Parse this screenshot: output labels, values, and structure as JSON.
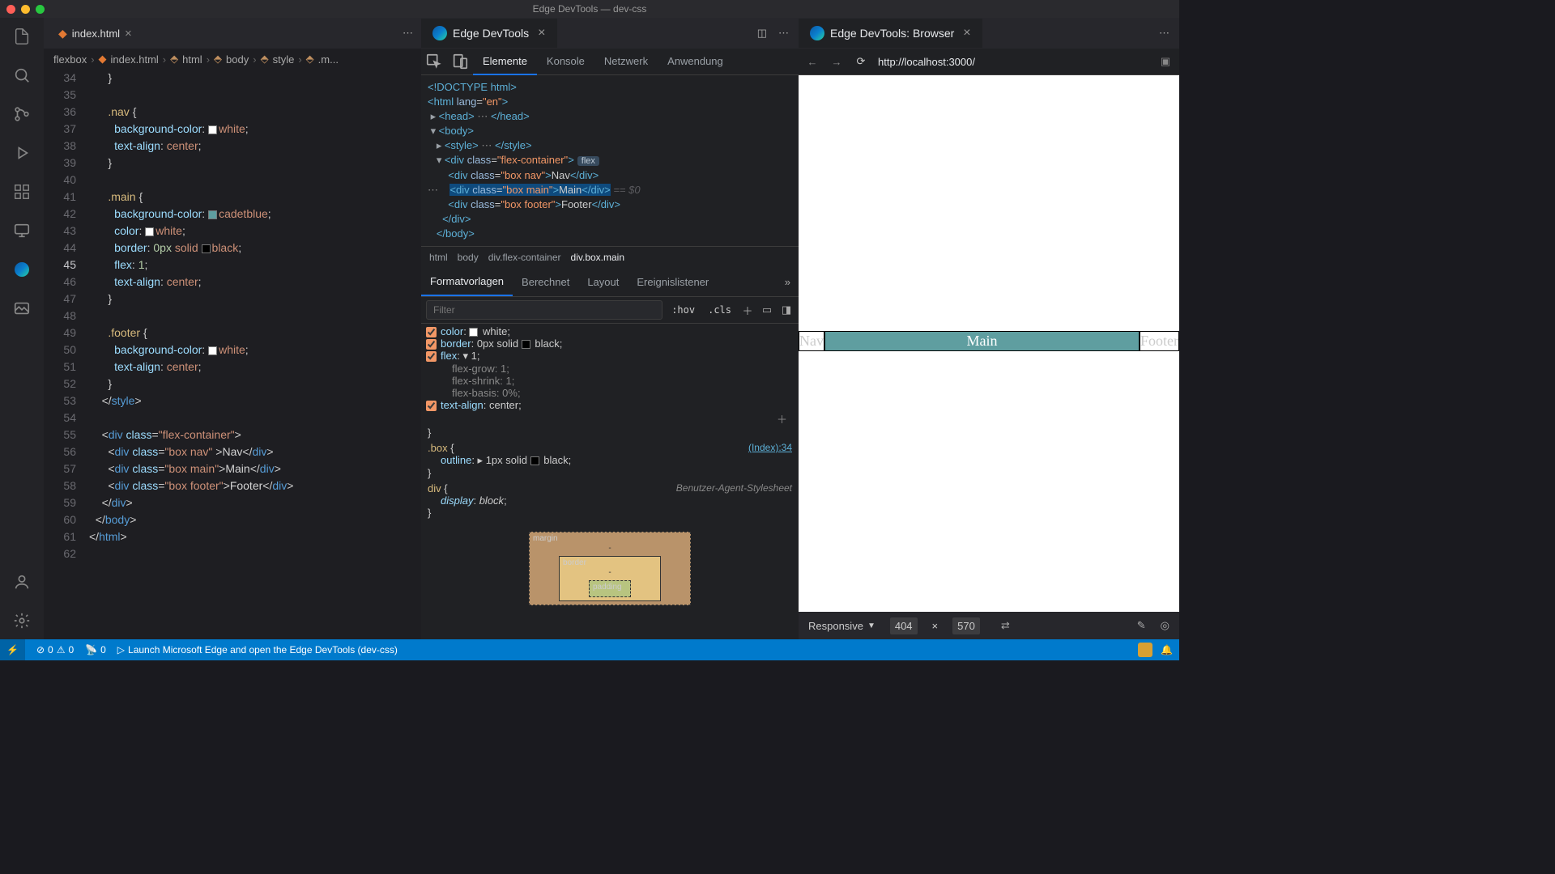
{
  "window": {
    "title": "Edge DevTools — dev-css"
  },
  "editor": {
    "tab": {
      "filename": "index.html"
    },
    "breadcrumb": [
      "flexbox",
      "index.html",
      "html",
      "body",
      "style",
      ".m..."
    ],
    "lines": [
      {
        "n": 34,
        "html": "      <span class='s-punc'>}</span>"
      },
      {
        "n": 35,
        "html": ""
      },
      {
        "n": 36,
        "html": "      <span class='s-sel'>.nav</span> <span class='s-punc'>{</span>"
      },
      {
        "n": 37,
        "html": "        <span class='s-prop'>background-color</span>: <span class='swatch sw-white'></span><span class='s-val'>white</span>;"
      },
      {
        "n": 38,
        "html": "        <span class='s-prop'>text-align</span>: <span class='s-val'>center</span>;"
      },
      {
        "n": 39,
        "html": "      <span class='s-punc'>}</span>"
      },
      {
        "n": 40,
        "html": ""
      },
      {
        "n": 41,
        "html": "      <span class='s-sel'>.main</span> <span class='s-punc'>{</span>"
      },
      {
        "n": 42,
        "html": "        <span class='s-prop'>background-color</span>: <span class='swatch sw-cadet'></span><span class='s-val'>cadetblue</span>;"
      },
      {
        "n": 43,
        "html": "        <span class='s-prop'>color</span>: <span class='swatch sw-white'></span><span class='s-val'>white</span>;"
      },
      {
        "n": 44,
        "html": "        <span class='s-prop'>border</span>: <span class='s-num'>0px</span> <span class='s-val'>solid</span> <span class='swatch sw-black'></span><span class='s-val'>black</span>;"
      },
      {
        "n": 45,
        "active": true,
        "html": "        <span class='s-prop'>flex</span>: <span class='s-num'>1</span>;"
      },
      {
        "n": 46,
        "html": "        <span class='s-prop'>text-align</span>: <span class='s-val'>center</span>;"
      },
      {
        "n": 47,
        "html": "      <span class='s-punc'>}</span>"
      },
      {
        "n": 48,
        "html": ""
      },
      {
        "n": 49,
        "html": "      <span class='s-sel'>.footer</span> <span class='s-punc'>{</span>"
      },
      {
        "n": 50,
        "html": "        <span class='s-prop'>background-color</span>: <span class='swatch sw-white'></span><span class='s-val'>white</span>;"
      },
      {
        "n": 51,
        "html": "        <span class='s-prop'>text-align</span>: <span class='s-val'>center</span>;"
      },
      {
        "n": 52,
        "html": "      <span class='s-punc'>}</span>"
      },
      {
        "n": 53,
        "html": "    <span class='s-punc'>&lt;/</span><span class='s-tag'>style</span><span class='s-punc'>&gt;</span>"
      },
      {
        "n": 54,
        "html": ""
      },
      {
        "n": 55,
        "html": "    <span class='s-punc'>&lt;</span><span class='s-tag'>div</span> <span class='s-attr'>class</span>=<span class='s-str'>\"flex-container\"</span><span class='s-punc'>&gt;</span>"
      },
      {
        "n": 56,
        "html": "      <span class='s-punc'>&lt;</span><span class='s-tag'>div</span> <span class='s-attr'>class</span>=<span class='s-str'>\"box nav\"</span> <span class='s-punc'>&gt;</span><span class='s-txt'>Nav</span><span class='s-punc'>&lt;/</span><span class='s-tag'>div</span><span class='s-punc'>&gt;</span>"
      },
      {
        "n": 57,
        "html": "      <span class='s-punc'>&lt;</span><span class='s-tag'>div</span> <span class='s-attr'>class</span>=<span class='s-str'>\"box main\"</span><span class='s-punc'>&gt;</span><span class='s-txt'>Main</span><span class='s-punc'>&lt;/</span><span class='s-tag'>div</span><span class='s-punc'>&gt;</span>"
      },
      {
        "n": 58,
        "html": "      <span class='s-punc'>&lt;</span><span class='s-tag'>div</span> <span class='s-attr'>class</span>=<span class='s-str'>\"box footer\"</span><span class='s-punc'>&gt;</span><span class='s-txt'>Footer</span><span class='s-punc'>&lt;/</span><span class='s-tag'>div</span><span class='s-punc'>&gt;</span>"
      },
      {
        "n": 59,
        "html": "    <span class='s-punc'>&lt;/</span><span class='s-tag'>div</span><span class='s-punc'>&gt;</span>"
      },
      {
        "n": 60,
        "html": "  <span class='s-punc'>&lt;/</span><span class='s-tag'>body</span><span class='s-punc'>&gt;</span>"
      },
      {
        "n": 61,
        "html": "<span class='s-punc'>&lt;/</span><span class='s-tag'>html</span><span class='s-punc'>&gt;</span>"
      },
      {
        "n": 62,
        "html": ""
      }
    ]
  },
  "devtools": {
    "tab_title": "Edge DevTools",
    "tool_tabs": [
      "Elemente",
      "Konsole",
      "Netzwerk",
      "Anwendung"
    ],
    "active_tool": 0,
    "dom_crumbs": [
      "html",
      "body",
      "div.flex-container",
      "div.box.main"
    ],
    "styles_tabs": [
      "Formatvorlagen",
      "Berechnet",
      "Layout",
      "Ereignislistener"
    ],
    "filter_placeholder": "Filter",
    "hov": ":hov",
    "cls": ".cls",
    "box_model": {
      "margin": "margin",
      "border": "border",
      "padding": "padding",
      "dash": "-"
    },
    "styles_rules": {
      "r1_props": [
        {
          "chk": true,
          "name": "color",
          "val": "white",
          "sw": "sw-white"
        },
        {
          "chk": true,
          "name": "border",
          "val": "0px solid ",
          "sw2": "sw-black",
          "val2": "black"
        },
        {
          "chk": true,
          "name": "flex",
          "val": "1",
          "expand": true
        }
      ],
      "r1_subs": [
        {
          "name": "flex-grow",
          "val": "1"
        },
        {
          "name": "flex-shrink",
          "val": "1"
        },
        {
          "name": "flex-basis",
          "val": "0%"
        }
      ],
      "r1_tail": {
        "chk": true,
        "name": "text-align",
        "val": "center"
      },
      "r2_sel": ".box",
      "r2_link": "(Index):34",
      "r2_prop": {
        "name": "outline",
        "val": "1px solid ",
        "sw2": "sw-black",
        "val2": "black"
      },
      "r3_sel": "div",
      "r3_ua": "Benutzer-Agent-Stylesheet",
      "r3_prop": {
        "name": "display",
        "val": "block"
      }
    }
  },
  "browser": {
    "tab_title": "Edge DevTools: Browser",
    "url": "http://localhost:3000/",
    "preview": {
      "nav": "Nav",
      "main": "Main",
      "footer": "Footer"
    },
    "device": {
      "name": "Responsive",
      "w": "404",
      "x": "×",
      "h": "570"
    }
  },
  "statusbar": {
    "errors": "0",
    "warnings": "0",
    "ports": "0",
    "hint": "Launch Microsoft Edge and open the Edge DevTools (dev-css)"
  }
}
